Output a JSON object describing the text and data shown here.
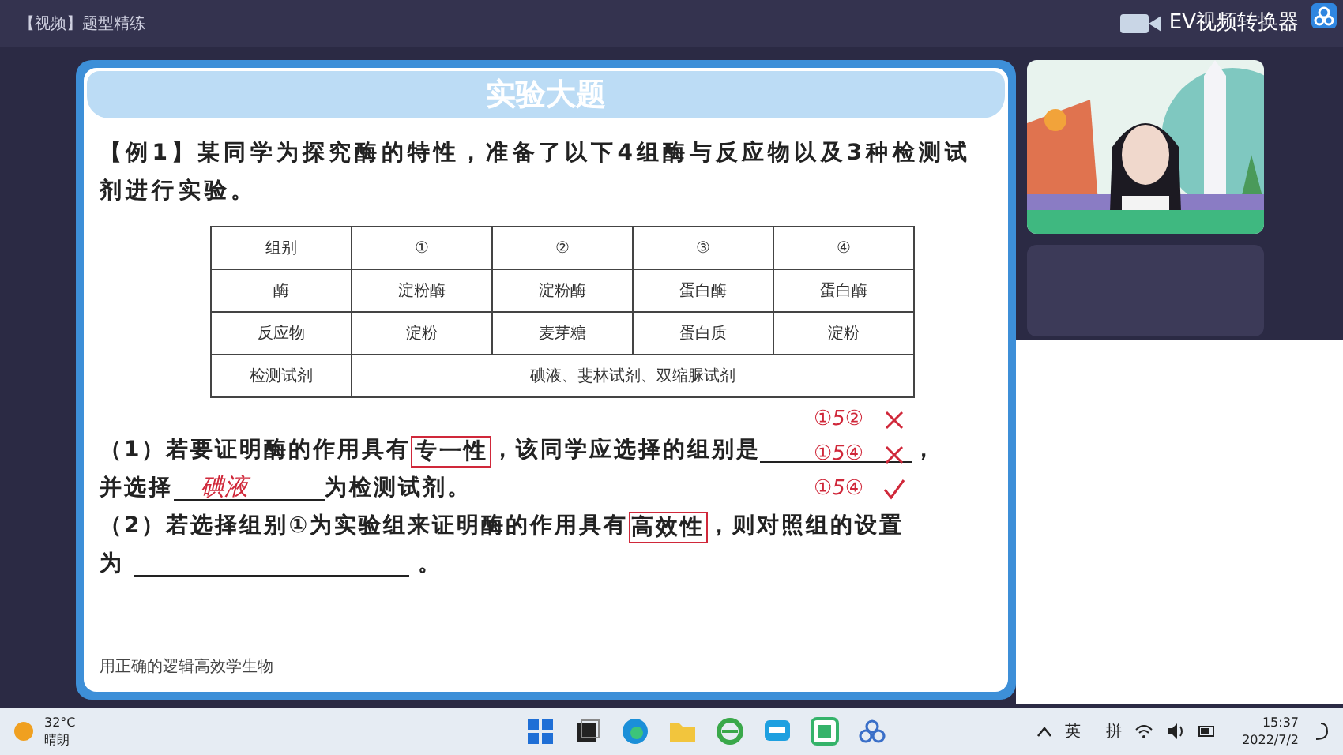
{
  "window": {
    "title": "【视频】题型精练",
    "overlay_label": "EV视频转换器"
  },
  "slide": {
    "banner": "实验大题",
    "intro": "【例1】某同学为探究酶的特性，准备了以下4组酶与反应物以及3种检测试剂进行实验。",
    "table": {
      "rows": [
        {
          "label": "组别",
          "cells": [
            {
              "text": "①"
            },
            {
              "text": "②"
            },
            {
              "text": "③"
            },
            {
              "text": "④"
            }
          ]
        },
        {
          "label": "酶",
          "cells": [
            {
              "text": "淀粉酶"
            },
            {
              "text": "淀粉酶"
            },
            {
              "text": "蛋白酶"
            },
            {
              "text": "蛋白酶"
            }
          ]
        },
        {
          "label": "反应物",
          "cells": [
            {
              "text": "淀粉"
            },
            {
              "text": "麦芽糖"
            },
            {
              "text": "蛋白质"
            },
            {
              "text": "淀粉"
            }
          ]
        },
        {
          "label": "检测试剂",
          "cells": [
            {
              "text": "碘液、斐林试剂、双缩脲试剂",
              "colspan": 4
            }
          ]
        }
      ]
    },
    "questions": [
      {
        "segments": [
          {
            "kind": "text",
            "text": "（1）若要证明酶的作用具有"
          },
          {
            "kind": "boxed",
            "text": "专一性"
          },
          {
            "kind": "text",
            "text": "，该同学应选择的组别是"
          },
          {
            "kind": "blank"
          },
          {
            "kind": "text",
            "text": "，"
          }
        ]
      },
      {
        "segments": [
          {
            "kind": "text",
            "text": "并选择"
          },
          {
            "kind": "blank"
          },
          {
            "kind": "text",
            "text": "为检测试剂。"
          }
        ]
      },
      {
        "segments": [
          {
            "kind": "text",
            "text": "（2）若选择组别①为实验组来证明酶的作用具有"
          },
          {
            "kind": "boxed",
            "text": "高效性"
          },
          {
            "kind": "text",
            "text": "，则对照组的设置"
          }
        ]
      },
      {
        "segments": [
          {
            "kind": "text",
            "text": "为"
          },
          {
            "kind": "long_blank"
          },
          {
            "kind": "text",
            "text": "。"
          }
        ]
      }
    ],
    "annotations": [
      {
        "text": "①5②",
        "kind": "cross"
      },
      {
        "text": "①5④",
        "kind": "cross"
      },
      {
        "text": "①5④",
        "kind": "tick"
      }
    ],
    "handwritten_answer": "碘液",
    "footer": "用正确的逻辑高效学生物"
  },
  "taskbar": {
    "temperature": "32°C",
    "weather": "晴朗",
    "ime_language": "英",
    "ime_mode": "拼",
    "time": "15:37",
    "date": "2022/7/2"
  }
}
